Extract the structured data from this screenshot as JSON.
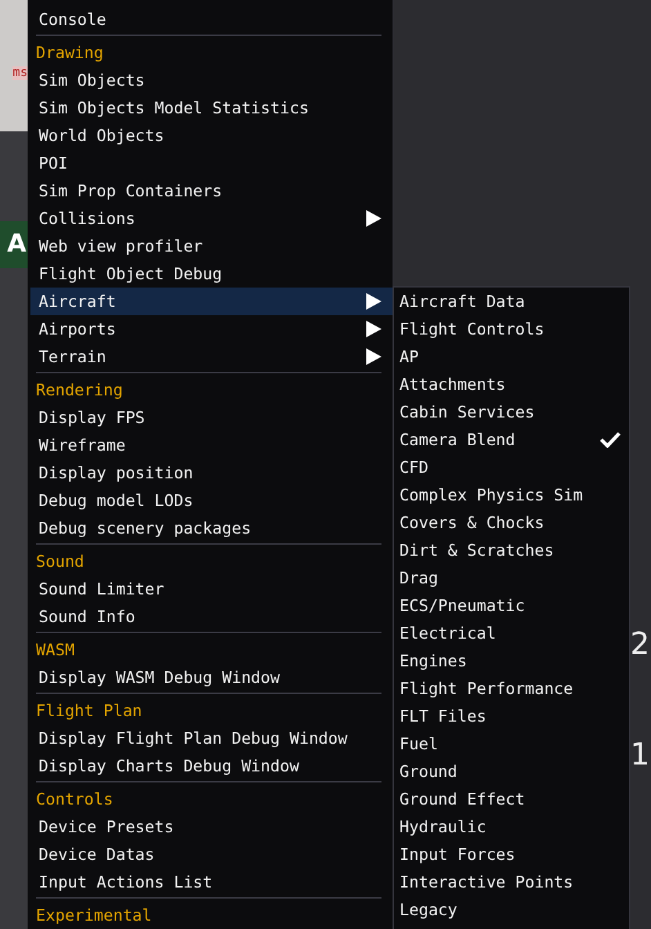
{
  "background": {
    "left_texts": [
      "ms"
    ],
    "badge": "A",
    "right_texts": [
      "2",
      "1"
    ]
  },
  "menu": {
    "sections": [
      {
        "items": [
          {
            "label": "Console",
            "submenu": false,
            "selected": false
          }
        ]
      },
      {
        "header": "Drawing",
        "items": [
          {
            "label": "Sim Objects",
            "submenu": false,
            "selected": false
          },
          {
            "label": "Sim Objects Model Statistics",
            "submenu": false,
            "selected": false
          },
          {
            "label": "World Objects",
            "submenu": false,
            "selected": false
          },
          {
            "label": "POI",
            "submenu": false,
            "selected": false
          },
          {
            "label": "Sim Prop Containers",
            "submenu": false,
            "selected": false
          },
          {
            "label": "Collisions",
            "submenu": true,
            "selected": false
          },
          {
            "label": "Web view profiler",
            "submenu": false,
            "selected": false
          },
          {
            "label": "Flight Object Debug",
            "submenu": false,
            "selected": false
          },
          {
            "label": "Aircraft",
            "submenu": true,
            "selected": true
          },
          {
            "label": "Airports",
            "submenu": true,
            "selected": false
          },
          {
            "label": "Terrain",
            "submenu": true,
            "selected": false
          }
        ]
      },
      {
        "header": "Rendering",
        "items": [
          {
            "label": "Display FPS",
            "submenu": false,
            "selected": false
          },
          {
            "label": "Wireframe",
            "submenu": false,
            "selected": false
          },
          {
            "label": "Display position",
            "submenu": false,
            "selected": false
          },
          {
            "label": "Debug model LODs",
            "submenu": false,
            "selected": false
          },
          {
            "label": "Debug scenery packages",
            "submenu": false,
            "selected": false
          }
        ]
      },
      {
        "header": "Sound",
        "items": [
          {
            "label": "Sound Limiter",
            "submenu": false,
            "selected": false
          },
          {
            "label": "Sound Info",
            "submenu": false,
            "selected": false
          }
        ]
      },
      {
        "header": "WASM",
        "items": [
          {
            "label": "Display WASM Debug Window",
            "submenu": false,
            "selected": false
          }
        ]
      },
      {
        "header": "Flight Plan",
        "items": [
          {
            "label": "Display Flight Plan Debug Window",
            "submenu": false,
            "selected": false
          },
          {
            "label": "Display Charts Debug Window",
            "submenu": false,
            "selected": false
          }
        ]
      },
      {
        "header": "Controls",
        "items": [
          {
            "label": "Device Presets",
            "submenu": false,
            "selected": false
          },
          {
            "label": "Device Datas",
            "submenu": false,
            "selected": false
          },
          {
            "label": "Input Actions List",
            "submenu": false,
            "selected": false
          }
        ]
      },
      {
        "header": "Experimental"
      }
    ]
  },
  "submenu": {
    "items": [
      {
        "label": "Aircraft Data",
        "checked": false
      },
      {
        "label": "Flight Controls",
        "checked": false
      },
      {
        "label": "AP",
        "checked": false
      },
      {
        "label": "Attachments",
        "checked": false
      },
      {
        "label": "Cabin Services",
        "checked": false
      },
      {
        "label": "Camera Blend",
        "checked": true
      },
      {
        "label": "CFD",
        "checked": false
      },
      {
        "label": "Complex Physics Sim",
        "checked": false
      },
      {
        "label": "Covers & Chocks",
        "checked": false
      },
      {
        "label": "Dirt & Scratches",
        "checked": false
      },
      {
        "label": "Drag",
        "checked": false
      },
      {
        "label": "ECS/Pneumatic",
        "checked": false
      },
      {
        "label": "Electrical",
        "checked": false
      },
      {
        "label": "Engines",
        "checked": false
      },
      {
        "label": "Flight Performance",
        "checked": false
      },
      {
        "label": "FLT Files",
        "checked": false
      },
      {
        "label": "Fuel",
        "checked": false
      },
      {
        "label": "Ground",
        "checked": false
      },
      {
        "label": "Ground Effect",
        "checked": false
      },
      {
        "label": "Hydraulic",
        "checked": false
      },
      {
        "label": "Input Forces",
        "checked": false
      },
      {
        "label": "Interactive Points",
        "checked": false
      },
      {
        "label": "Legacy",
        "checked": false
      }
    ]
  }
}
